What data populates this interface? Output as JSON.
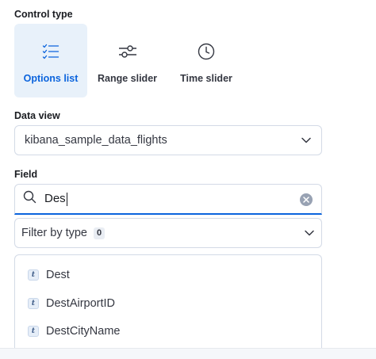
{
  "control_type": {
    "label": "Control type",
    "options": [
      {
        "label": "Options list",
        "icon": "checklist-icon",
        "selected": true
      },
      {
        "label": "Range slider",
        "icon": "sliders-icon",
        "selected": false
      },
      {
        "label": "Time slider",
        "icon": "clock-icon",
        "selected": false
      }
    ]
  },
  "data_view": {
    "label": "Data view",
    "value": "kibana_sample_data_flights"
  },
  "field": {
    "label": "Field",
    "search_value": "Des",
    "filter_label": "Filter by type",
    "filter_count": "0",
    "items": [
      {
        "type_token": "t",
        "name": "Dest"
      },
      {
        "type_token": "t",
        "name": "DestAirportID"
      },
      {
        "type_token": "t",
        "name": "DestCityName"
      }
    ]
  },
  "colors": {
    "accent": "#0b64dd",
    "selected_bg": "#e8f1fa",
    "border": "#d3dae6"
  }
}
